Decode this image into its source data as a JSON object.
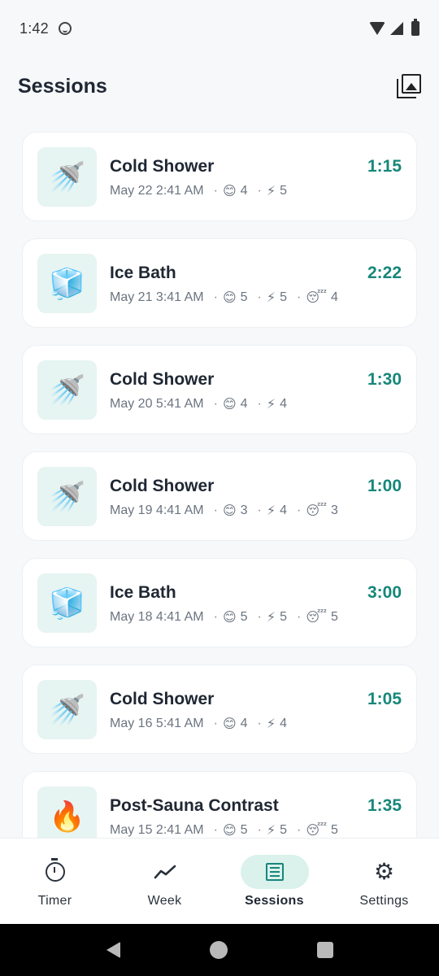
{
  "status_bar": {
    "time": "1:42"
  },
  "header": {
    "title": "Sessions"
  },
  "sessions": [
    {
      "title": "Cold Shower",
      "date": "May 22 2:41 AM",
      "duration": "1:15",
      "icon": "🚿",
      "icon_name": "shower-icon",
      "mood": "4",
      "energy": "5",
      "sleep": null
    },
    {
      "title": "Ice Bath",
      "date": "May 21 3:41 AM",
      "duration": "2:22",
      "icon": "🧊",
      "icon_name": "ice-cube-icon",
      "mood": "5",
      "energy": "5",
      "sleep": "4"
    },
    {
      "title": "Cold Shower",
      "date": "May 20 5:41 AM",
      "duration": "1:30",
      "icon": "🚿",
      "icon_name": "shower-icon",
      "mood": "4",
      "energy": "4",
      "sleep": null
    },
    {
      "title": "Cold Shower",
      "date": "May 19 4:41 AM",
      "duration": "1:00",
      "icon": "🚿",
      "icon_name": "shower-icon",
      "mood": "3",
      "energy": "4",
      "sleep": "3"
    },
    {
      "title": "Ice Bath",
      "date": "May 18 4:41 AM",
      "duration": "3:00",
      "icon": "🧊",
      "icon_name": "ice-cube-icon",
      "mood": "5",
      "energy": "5",
      "sleep": "5"
    },
    {
      "title": "Cold Shower",
      "date": "May 16 5:41 AM",
      "duration": "1:05",
      "icon": "🚿",
      "icon_name": "shower-icon",
      "mood": "4",
      "energy": "4",
      "sleep": null
    },
    {
      "title": "Post-Sauna Contrast",
      "date": "May 15 2:41 AM",
      "duration": "1:35",
      "icon": "🔥",
      "icon_name": "fire-icon",
      "mood": "5",
      "energy": "5",
      "sleep": "5"
    }
  ],
  "meta_icons": {
    "mood": "😊",
    "energy": "⚡",
    "sleep": "😴",
    "separator": "·"
  },
  "bottom_nav": [
    {
      "label": "Timer",
      "icon": "timer-icon",
      "active": false
    },
    {
      "label": "Week",
      "icon": "trend-icon",
      "active": false
    },
    {
      "label": "Sessions",
      "icon": "list-icon",
      "active": true
    },
    {
      "label": "Settings",
      "icon": "gear-icon",
      "active": false
    }
  ],
  "colors": {
    "accent": "#17877a",
    "active_pill": "#daf1ec",
    "thumb_bg": "#e6f4f2",
    "background": "#f6f8fa"
  }
}
